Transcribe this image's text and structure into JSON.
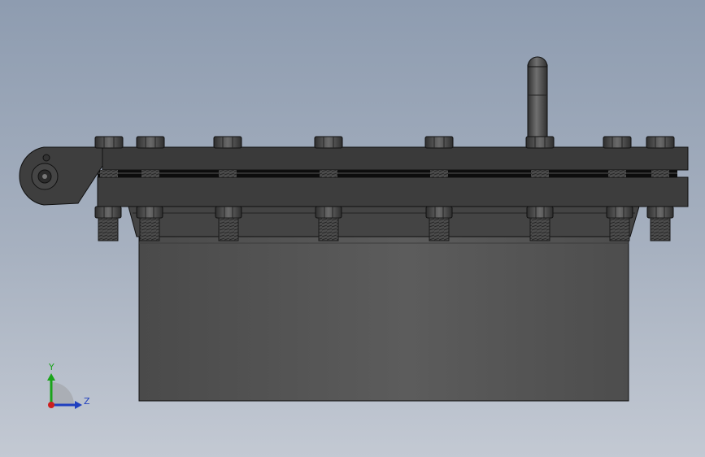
{
  "viewport": {
    "background_top": "#8e9cb0",
    "background_bottom": "#c3c9d3"
  },
  "model": {
    "body_color": "#555555",
    "flange_color": "#3a3a3a",
    "bolt_color": "#4a4a4a",
    "edge_color": "#111111",
    "gasket_color": "#0c0c0c",
    "bolt_count_top": 8,
    "bolt_count_bottom": 8,
    "has_hinge": true,
    "has_handle": true
  },
  "triad": {
    "y_label": "Y",
    "z_label": "Z",
    "y_color": "#1aa31a",
    "z_color": "#1f3fbf",
    "x_color": "#cc1f1f"
  }
}
